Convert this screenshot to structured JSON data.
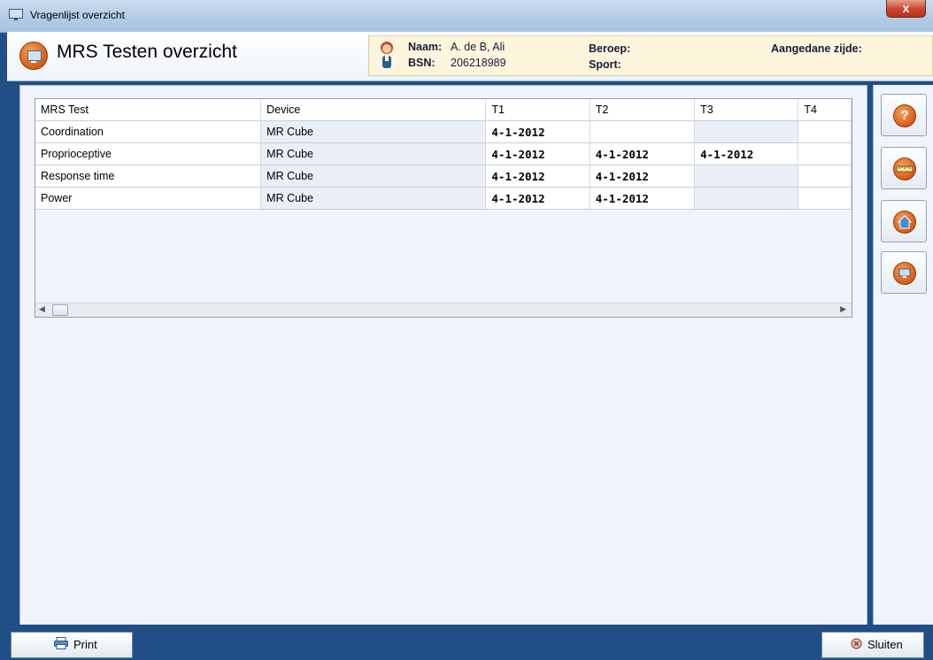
{
  "window": {
    "title": "Vragenlijst overzicht",
    "close_label": "x"
  },
  "header": {
    "title": "MRS Testen overzicht",
    "patient": {
      "name_label": "Naam:",
      "name_value": "A. de B, Ali",
      "bsn_label": "BSN:",
      "bsn_value": "206218989",
      "beroep_label": "Beroep:",
      "sport_label": "Sport:",
      "zijde_label": "Aangedane zijde:"
    }
  },
  "grid": {
    "columns": [
      "MRS Test",
      "Device",
      "T1",
      "T2",
      "T3",
      "T4"
    ],
    "rows": [
      {
        "test": "Coordination",
        "device": "MR Cube",
        "t1": "4-1-2012",
        "t2": "",
        "t3": "",
        "t4": ""
      },
      {
        "test": "Proprioceptive",
        "device": "MR Cube",
        "t1": "4-1-2012",
        "t2": "4-1-2012",
        "t3": "4-1-2012",
        "t4": ""
      },
      {
        "test": "Response time",
        "device": "MR Cube",
        "t1": "4-1-2012",
        "t2": "4-1-2012",
        "t3": "",
        "t4": ""
      },
      {
        "test": "Power",
        "device": "MR Cube",
        "t1": "4-1-2012",
        "t2": "4-1-2012",
        "t3": "",
        "t4": ""
      }
    ]
  },
  "sidebar": {
    "buttons": [
      "help-icon",
      "ruler-icon",
      "home-icon",
      "monitor-icon"
    ]
  },
  "footer": {
    "print_label": "Print",
    "close_label": "Sluiten"
  },
  "colors": {
    "accent": "#e0631e",
    "frame": "#1f4f86"
  }
}
